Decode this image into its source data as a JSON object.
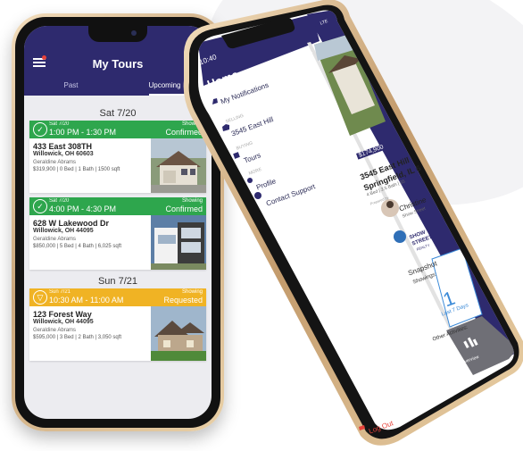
{
  "left_app": {
    "title": "My Tours",
    "tabs": [
      {
        "label": "Past",
        "active": false
      },
      {
        "label": "Upcoming",
        "active": true
      }
    ],
    "days": [
      {
        "label": "Sat 7/20"
      },
      {
        "label": "Sun 7/21"
      }
    ],
    "tours": [
      {
        "date": "Sat 7/20",
        "time": "1:00 PM - 1:30 PM",
        "status_small": "Showing",
        "status": "Confirmed",
        "status_color": "#2ea64d",
        "address": "433 East 308TH",
        "city": "Willowick, OH 60603",
        "agent": "Geraldine Abrams",
        "details": "$319,900 | 0 Bed | 1 Bath | 1500 sqft"
      },
      {
        "date": "Sat 7/20",
        "time": "4:00 PM - 4:30 PM",
        "status_small": "Showing",
        "status": "Confirmed",
        "status_color": "#2ea64d",
        "address": "628 W Lakewood Dr",
        "city": "Willowick, OH 44095",
        "agent": "Geraldine Abrams",
        "details": "$850,000 | 5 Bed | 4 Bath | 6,025 sqft"
      },
      {
        "date": "Sun 7/21",
        "time": "10:30 AM - 11:00 AM",
        "status_small": "Showing",
        "status": "Requested",
        "status_color": "#f0b324",
        "address": "123 Forest Way",
        "city": "Willowick, OH 44095",
        "agent": "Geraldine Abrams",
        "details": "$595,000 | 3 Bed | 2 Bath | 3,050 sqft"
      }
    ]
  },
  "right_app": {
    "clock": "10:40",
    "status_icons": "LTE",
    "logo": "Home",
    "logo_sub": "by Showingtime",
    "menu": [
      {
        "label": "My Notifications",
        "icon": "bell-icon"
      },
      {
        "section": "SELLING",
        "label": "3545 East Hill",
        "icon": "house-icon"
      },
      {
        "section": "BUYING",
        "label": "Tours",
        "icon": "calendar-icon"
      },
      {
        "section": "MORE",
        "label": "Profile",
        "icon": "person-icon"
      },
      {
        "label": "Contact Support",
        "icon": "help-icon"
      }
    ],
    "logout": "Log Out",
    "listing": {
      "price": "$174,900",
      "address": "3545 East Hill",
      "city": "Springfield, IL 6",
      "details": "4 Bed | 2.5 Bath | 35",
      "prepared_by": "Prepared by",
      "agent_name": "Christine",
      "agent_company": "Show Street",
      "brokerage_line1": "SHOW",
      "brokerage_line2": "STREET",
      "brokerage_line3": "REALTY"
    },
    "snapshot": {
      "title": "Snapshot",
      "showings_label": "Showings:",
      "showings_count": "1",
      "period": "Last 7 Days",
      "other_label": "Other Activities:"
    },
    "overview_label": "Overview"
  }
}
